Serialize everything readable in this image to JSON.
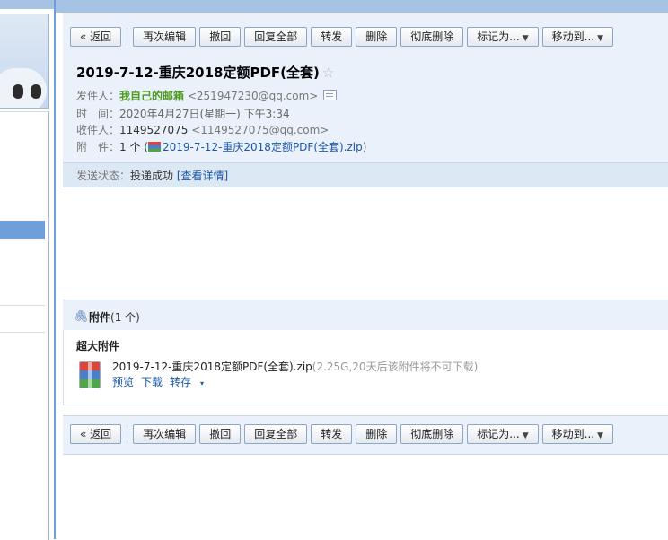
{
  "toolbar": {
    "back": "« 返回",
    "edit_again": "再次编辑",
    "recall": "撤回",
    "reply_all": "回复全部",
    "forward": "转发",
    "delete": "删除",
    "delete_permanently": "彻底删除",
    "mark_as": "标记为...",
    "move_to": "移动到..."
  },
  "mail": {
    "subject": "2019-7-12-重庆2018定额PDF(全套)",
    "star_glyph": "☆",
    "from_label": "发件人：",
    "from_name": "我自己的邮箱",
    "from_addr": "<251947230@qq.com>",
    "time_label": "时　间：",
    "time_value": "2020年4月27日(星期一) 下午3:34",
    "to_label": "收件人：",
    "to_name": "1149527075",
    "to_addr": "<1149527075@qq.com>",
    "attach_label": "附　件：",
    "attach_count": "1 个 (",
    "attach_file": "2019-7-12-重庆2018定额PDF(全套).zip",
    "attach_close": ")",
    "status_label": "发送状态：",
    "status_value": "投递成功",
    "status_link": "[查看详情]"
  },
  "attachments": {
    "header_title": "附件",
    "header_count": "(1 个)",
    "category": "超大附件",
    "file_name": "2019-7-12-重庆2018定额PDF(全套).zip",
    "file_meta": "(2.25G,20天后该附件将不可下载)",
    "preview": "预览",
    "download": "下载",
    "save_to": "转存",
    "caret": "▾"
  },
  "icons": {
    "clip": "paperclip-icon",
    "card": "contact-card-icon",
    "zip": "zip-archive-icon",
    "star": "star-icon"
  },
  "colors": {
    "accent": "#6f9fd8",
    "link": "#1a57a8",
    "sender": "#4c9b1f",
    "header_bg": "#eaf1fa"
  }
}
